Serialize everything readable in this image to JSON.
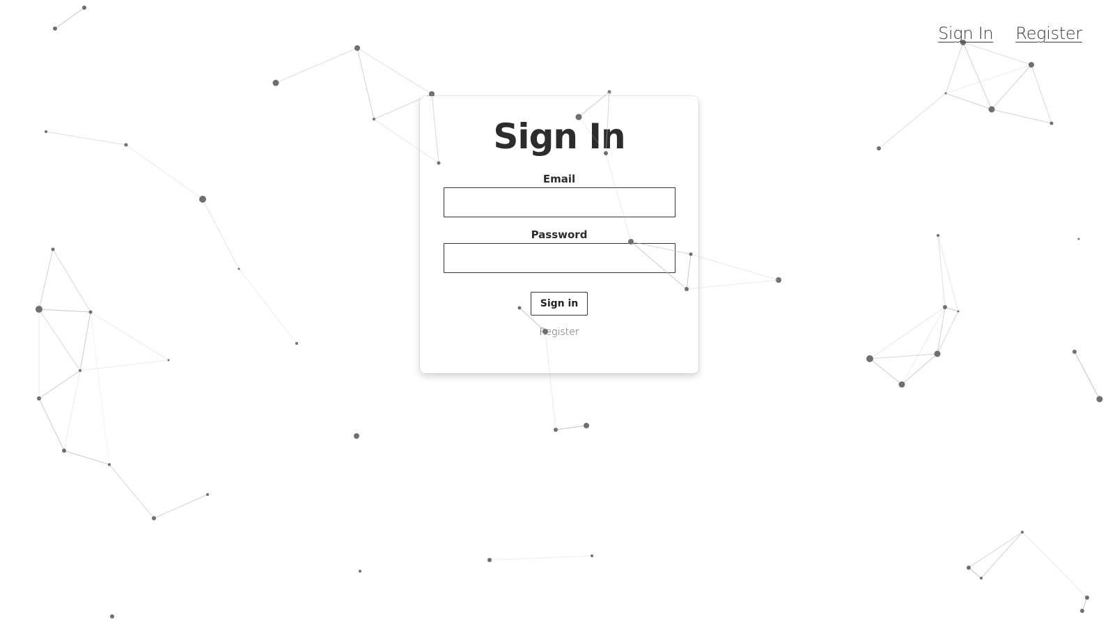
{
  "nav": {
    "signin_label": "Sign In",
    "register_label": "Register"
  },
  "form": {
    "title": "Sign In",
    "email_label": "Email",
    "email_value": "",
    "password_label": "Password",
    "password_value": "",
    "submit_label": "Sign in",
    "register_link": "Register"
  },
  "background": {
    "type": "particle-network",
    "node_color": "#6f6f6f",
    "link_color": "#bdbdbd"
  }
}
